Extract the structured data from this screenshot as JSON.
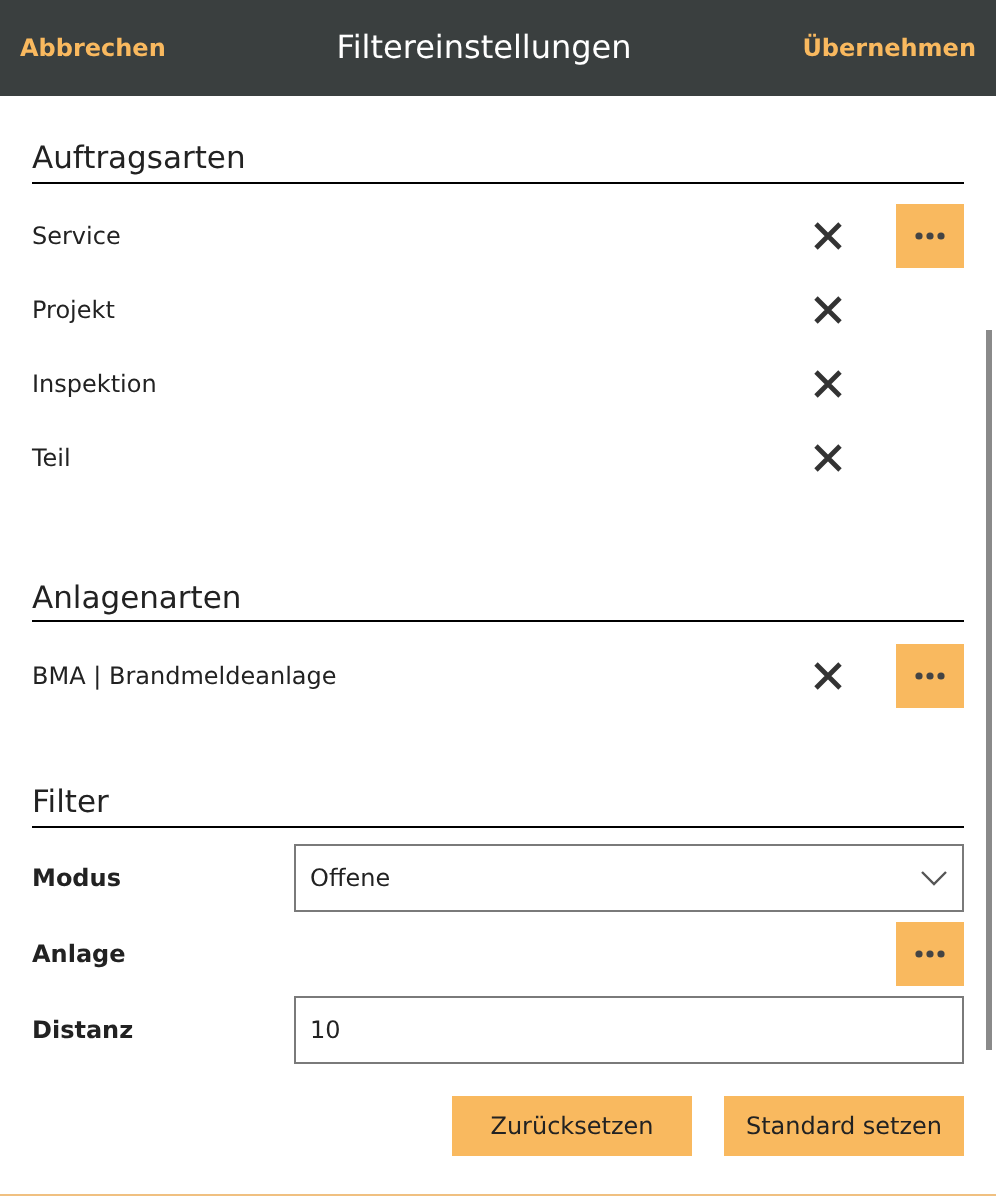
{
  "header": {
    "cancel": "Abbrechen",
    "title": "Filtereinstellungen",
    "apply": "Übernehmen"
  },
  "sections": [
    {
      "title": "Auftragsarten",
      "items": [
        {
          "label": "Service",
          "has_more": true
        },
        {
          "label": "Projekt",
          "has_more": false
        },
        {
          "label": "Inspektion",
          "has_more": false
        },
        {
          "label": "Teil",
          "has_more": false
        }
      ]
    },
    {
      "title": "Anlagenarten",
      "items": [
        {
          "label": "BMA  |  Brandmeldeanlage",
          "has_more": true
        }
      ]
    }
  ],
  "filter": {
    "title": "Filter",
    "fields": [
      {
        "kind": "select",
        "label": "Modus",
        "value": "Offene"
      },
      {
        "kind": "picker",
        "label": "Anlage"
      },
      {
        "kind": "text",
        "label": "Distanz",
        "value": "10"
      }
    ]
  },
  "buttons": [
    "Zurücksetzen",
    "Standard setzen"
  ]
}
